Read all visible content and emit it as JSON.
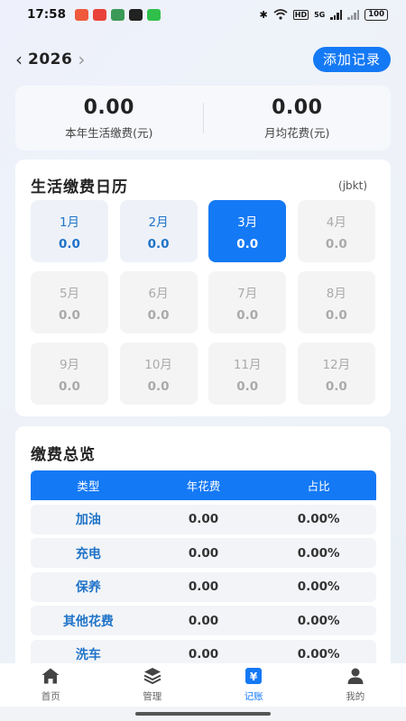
{
  "status_bar": {
    "time": "17:58",
    "hd_label": "HD",
    "signal_label": "5G",
    "battery": "100"
  },
  "header": {
    "year": "2026",
    "add_button": "添加记录"
  },
  "summary": {
    "yearly_value": "0.00",
    "yearly_label": "本年生活缴费(元)",
    "monthly_value": "0.00",
    "monthly_label": "月均花费(元)"
  },
  "calendar": {
    "title": "生活缴费日历",
    "code": "(jbkt)",
    "months": [
      {
        "label": "1月",
        "value": "0.0",
        "state": "past"
      },
      {
        "label": "2月",
        "value": "0.0",
        "state": "past"
      },
      {
        "label": "3月",
        "value": "0.0",
        "state": "current"
      },
      {
        "label": "4月",
        "value": "0.0",
        "state": "future"
      },
      {
        "label": "5月",
        "value": "0.0",
        "state": "future"
      },
      {
        "label": "6月",
        "value": "0.0",
        "state": "future"
      },
      {
        "label": "7月",
        "value": "0.0",
        "state": "future"
      },
      {
        "label": "8月",
        "value": "0.0",
        "state": "future"
      },
      {
        "label": "9月",
        "value": "0.0",
        "state": "future"
      },
      {
        "label": "10月",
        "value": "0.0",
        "state": "future"
      },
      {
        "label": "11月",
        "value": "0.0",
        "state": "future"
      },
      {
        "label": "12月",
        "value": "0.0",
        "state": "future"
      }
    ]
  },
  "overview": {
    "title": "缴费总览",
    "columns": [
      "类型",
      "年花费",
      "占比"
    ],
    "rows": [
      {
        "type": "加油",
        "cost": "0.00",
        "ratio": "0.00%"
      },
      {
        "type": "充电",
        "cost": "0.00",
        "ratio": "0.00%"
      },
      {
        "type": "保养",
        "cost": "0.00",
        "ratio": "0.00%"
      },
      {
        "type": "其他花费",
        "cost": "0.00",
        "ratio": "0.00%"
      },
      {
        "type": "洗车",
        "cost": "0.00",
        "ratio": "0.00%"
      }
    ]
  },
  "bottom_nav": {
    "items": [
      {
        "label": "首页",
        "icon": "home-icon",
        "active": false
      },
      {
        "label": "管理",
        "icon": "layers-icon",
        "active": false
      },
      {
        "label": "记账",
        "icon": "yen-icon",
        "active": true
      },
      {
        "label": "我的",
        "icon": "user-icon",
        "active": false
      }
    ]
  },
  "colors": {
    "accent": "#1479f5",
    "past_month_text": "#1f73c8",
    "future_month_text": "#aaaaaa"
  }
}
